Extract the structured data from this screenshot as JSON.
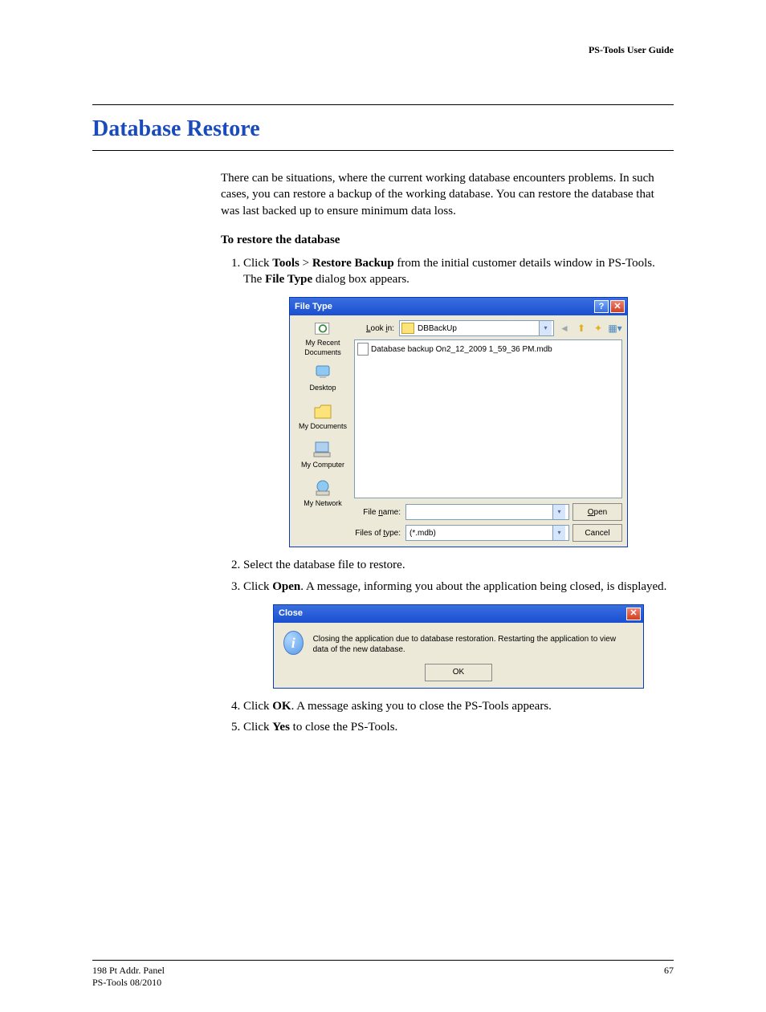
{
  "header": {
    "guide": "PS-Tools User Guide"
  },
  "title": "Database Restore",
  "intro": "There can be situations, where the current working database encounters problems. In such cases, you can restore a backup of the working database. You can restore the database that was last backed up to ensure minimum data loss.",
  "subhead": "To restore the database",
  "step1": {
    "a": "Click ",
    "b": "Tools",
    "c": " > ",
    "d": "Restore Backup",
    "e": " from the initial customer details window in PS-Tools. The ",
    "f": "File Type",
    "g": " dialog box appears."
  },
  "filedlg": {
    "title": "File Type",
    "look_label": "Look in:",
    "look_value": "DBBackUp",
    "file_item": "Database backup On2_12_2009 1_59_36 PM.mdb",
    "sidebar": [
      "My Recent Documents",
      "Desktop",
      "My Documents",
      "My Computer",
      "My Network"
    ],
    "filename_label": "File name:",
    "filename_value": "",
    "type_label": "Files of type:",
    "type_value": "(*.mdb)",
    "open": "Open",
    "cancel": "Cancel"
  },
  "step2": "Select the database file to restore.",
  "step3": {
    "a": "Click ",
    "b": "Open",
    "c": ". A message, informing you about the application being closed, is displayed."
  },
  "msgbox": {
    "title": "Close",
    "text": "Closing the application due to database restoration. Restarting the application to view data of the new database.",
    "ok": "OK"
  },
  "step4": {
    "a": "Click ",
    "b": "OK",
    "c": ". A message asking you to close the PS-Tools appears."
  },
  "step5": {
    "a": "Click ",
    "b": "Yes",
    "c": " to close the PS-Tools."
  },
  "footer": {
    "l1": "198 Pt Addr. Panel",
    "l2": "PS-Tools  08/2010",
    "page": "67"
  }
}
